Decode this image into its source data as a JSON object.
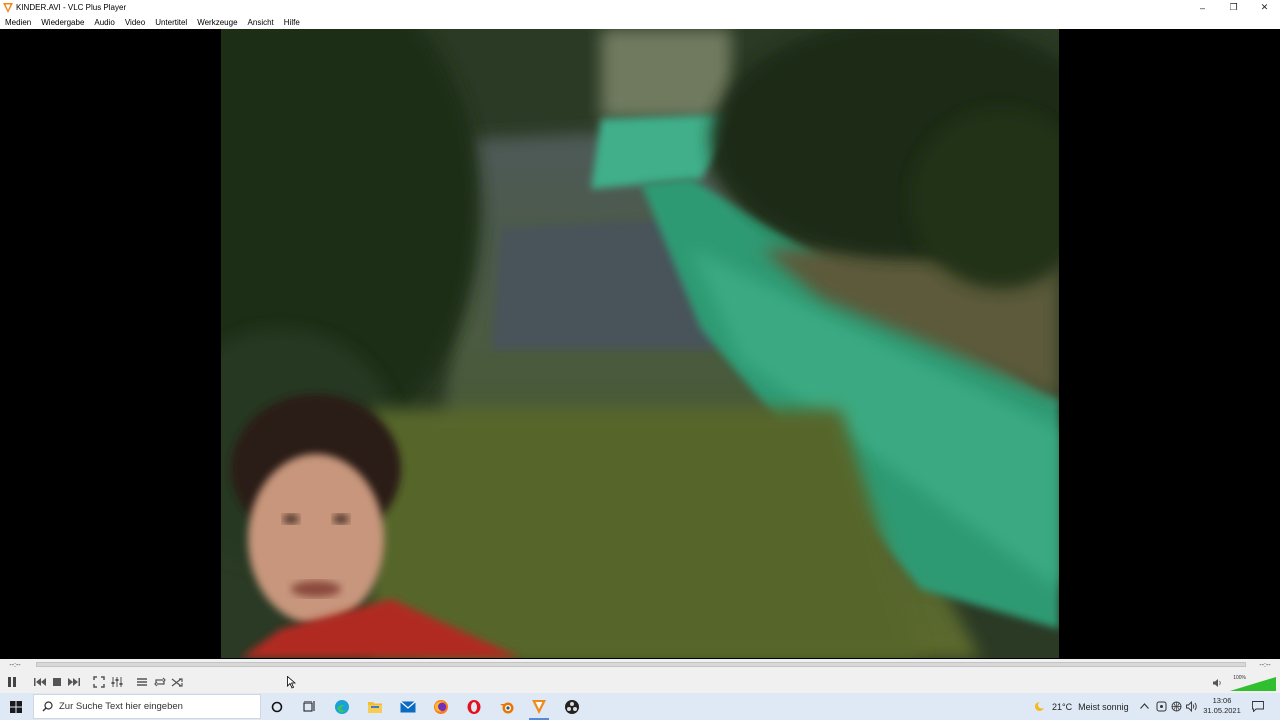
{
  "window": {
    "title": "KINDER.AVI - VLC Plus Player",
    "minimize_glyph": "–",
    "restore_glyph": "❐",
    "close_glyph": "✕"
  },
  "menu": {
    "items": [
      "Medien",
      "Wiedergabe",
      "Audio",
      "Video",
      "Untertitel",
      "Werkzeuge",
      "Ansicht",
      "Hilfe"
    ]
  },
  "player": {
    "time_elapsed": "--:--",
    "time_total": "--:--",
    "seek_position": 0,
    "volume_label": "100%",
    "volume_level": 1.0,
    "accent": "#2fbf2f"
  },
  "controls": {
    "buttons": [
      "pause-icon",
      "previous-icon",
      "stop-icon",
      "next-icon",
      "fullscreen-icon",
      "extended-settings-icon",
      "playlist-icon",
      "loop-icon",
      "shuffle-icon"
    ]
  },
  "taskbar": {
    "search_placeholder": "Zur Suche Text hier eingeben",
    "weather_temp": "21°C",
    "weather_desc": "Meist sonnig",
    "clock_time": "13:06",
    "clock_date": "31.05.2021",
    "pinned": [
      "cortana-icon",
      "task-view-icon",
      "edge-icon",
      "file-explorer-icon",
      "mail-icon",
      "firefox-icon",
      "opera-icon",
      "blender-icon",
      "vlc-icon",
      "obs-icon"
    ]
  }
}
